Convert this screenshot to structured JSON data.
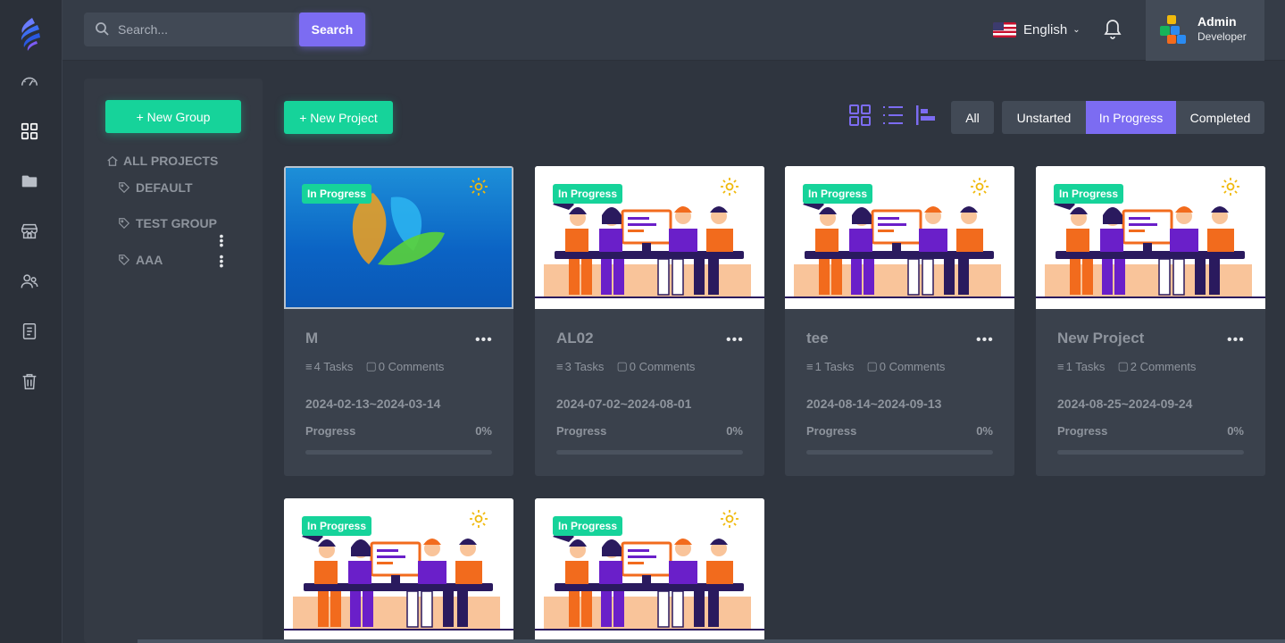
{
  "search": {
    "placeholder": "Search...",
    "button_label": "Search"
  },
  "header": {
    "language": "English",
    "user": {
      "name": "Admin",
      "role": "Developer"
    }
  },
  "groups": {
    "new_group_label": "+ New Group",
    "all_projects_label": "ALL PROJECTS",
    "items": [
      {
        "label": "DEFAULT"
      },
      {
        "label": "TEST GROUP"
      },
      {
        "label": "AAA"
      }
    ]
  },
  "toolbar": {
    "new_project_label": "+ New Project",
    "filters": [
      {
        "label": "All",
        "active": false
      },
      {
        "label": "Unstarted",
        "active": false
      },
      {
        "label": "In Progress",
        "active": true
      },
      {
        "label": "Completed",
        "active": false
      }
    ]
  },
  "projects": [
    {
      "title": "M",
      "status": "In Progress",
      "tasks": "4 Tasks",
      "comments": "0 Comments",
      "dates": "2024-02-13~2024-03-14",
      "progress_label": "Progress",
      "progress": "0%",
      "thumbnail": "blue-leaves"
    },
    {
      "title": "AL02",
      "status": "In Progress",
      "tasks": "3 Tasks",
      "comments": "0 Comments",
      "dates": "2024-07-02~2024-08-01",
      "progress_label": "Progress",
      "progress": "0%",
      "thumbnail": "team-illustration"
    },
    {
      "title": "tee",
      "status": "In Progress",
      "tasks": "1 Tasks",
      "comments": "0 Comments",
      "dates": "2024-08-14~2024-09-13",
      "progress_label": "Progress",
      "progress": "0%",
      "thumbnail": "team-illustration"
    },
    {
      "title": "New Project",
      "status": "In Progress",
      "tasks": "1 Tasks",
      "comments": "2 Comments",
      "dates": "2024-08-25~2024-09-24",
      "progress_label": "Progress",
      "progress": "0%",
      "thumbnail": "team-illustration"
    },
    {
      "status": "In Progress",
      "thumbnail": "team-illustration"
    },
    {
      "status": "In Progress",
      "thumbnail": "team-illustration"
    }
  ],
  "colors": {
    "accent": "#7c6cf2",
    "green": "#16d39a",
    "gear": "#f0b90c",
    "orange": "#f26b1d",
    "purple": "#6a1fc9"
  }
}
